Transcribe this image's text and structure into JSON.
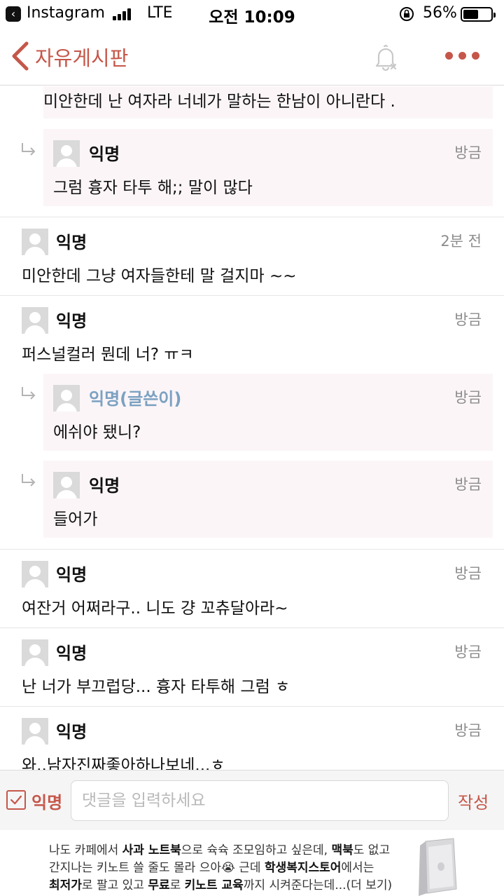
{
  "status_bar": {
    "back_app": "Instagram",
    "network": "LTE",
    "time": "오전 10:09",
    "battery_percent": "56%",
    "battery_level": 0.56
  },
  "nav": {
    "title": "자유게시판",
    "accent_color": "#c5574a"
  },
  "comments": [
    {
      "type": "reply",
      "author": "",
      "time": "",
      "text": "미안한데 난 여자라 너네가 말하는 한남이 아니란다 ."
    },
    {
      "type": "reply",
      "author": "익명",
      "time": "방금",
      "text": "그럼 흉자 타투 해;; 말이 많다"
    },
    {
      "type": "comment",
      "author": "익명",
      "time": "2분 전",
      "text": "미안한데 그냥 여자들한테 말 걸지마 ~~"
    },
    {
      "type": "comment",
      "author": "익명",
      "time": "방금",
      "text": "퍼스널컬러 뭔데 너? ㅠㅋ"
    },
    {
      "type": "reply",
      "author": "익명(글쓴이)",
      "time": "방금",
      "text": "에쉬야 됐니?",
      "is_op": true
    },
    {
      "type": "reply",
      "author": "익명",
      "time": "방금",
      "text": "들어가"
    },
    {
      "type": "comment",
      "author": "익명",
      "time": "방금",
      "text": "여잔거 어쩌라구.. 니도 걍 꼬츄달아라~"
    },
    {
      "type": "comment",
      "author": "익명",
      "time": "방금",
      "text": "난 너가 부끄럽당... 흉자 타투해 그럼 ㅎ"
    },
    {
      "type": "comment",
      "author": "익명",
      "time": "방금",
      "text": "와..남자진짜좋아하나보네...ㅎ"
    }
  ],
  "composer": {
    "anon_label": "익명",
    "anon_checked": true,
    "placeholder": "댓글을 입력하세요",
    "submit_label": "작성"
  },
  "ad": {
    "line1": [
      {
        "t": "나도 카페에서 ",
        "b": false
      },
      {
        "t": "사과 노트북",
        "b": true
      },
      {
        "t": "으로 슉슉 조모임하고 싶은데, ",
        "b": false
      },
      {
        "t": "맥북",
        "b": true
      },
      {
        "t": "도 없고",
        "b": false
      }
    ],
    "line2": [
      {
        "t": "간지나는 키노트 쓸 줄도 몰라 으아😭 근데 ",
        "b": false
      },
      {
        "t": "학생복지스토어",
        "b": true
      },
      {
        "t": "에서는",
        "b": false
      }
    ],
    "line3": [
      {
        "t": "최저가",
        "b": true
      },
      {
        "t": "로 팔고 있고 ",
        "b": false
      },
      {
        "t": "무료",
        "b": true
      },
      {
        "t": "로 ",
        "b": false
      },
      {
        "t": "키노트 교육",
        "b": true
      },
      {
        "t": "까지 시켜준다는데...(더 보기)",
        "b": false
      }
    ]
  }
}
